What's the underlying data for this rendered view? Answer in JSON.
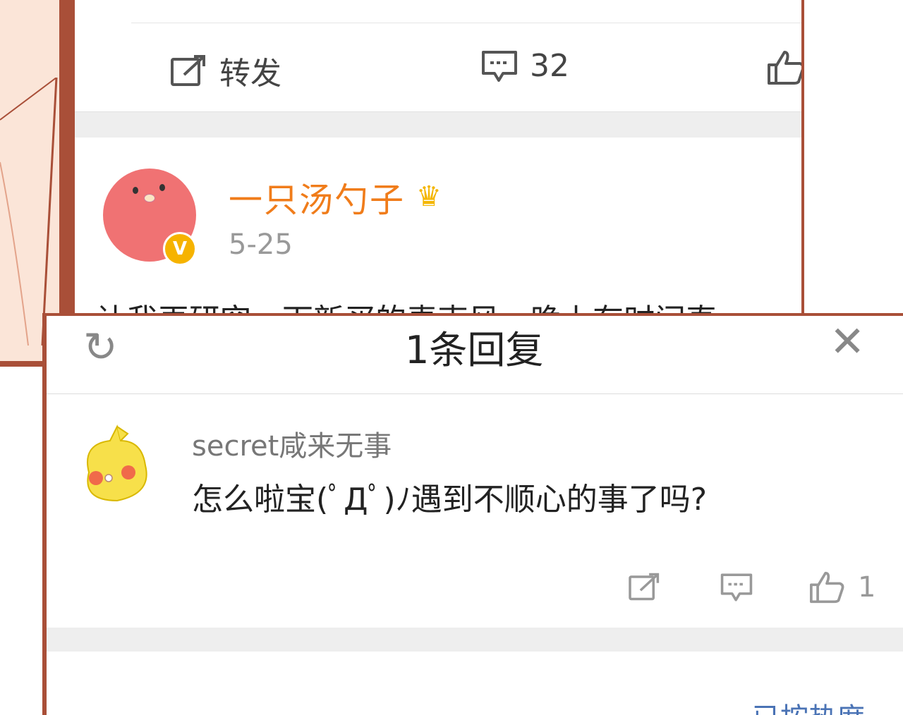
{
  "post": {
    "actions": {
      "share_label": "转发",
      "comment_count": "32"
    },
    "author": {
      "name": "一只汤勺子",
      "verified_badge": "V"
    },
    "date": "5-25",
    "text_partial": "让我再研究一下新买的麦克风，晚上有时间直"
  },
  "replies_dialog": {
    "title": "1条回复",
    "reply": {
      "username": "secret咸来无事",
      "text": "怎么啦宝(ﾟДﾟ)ﾉ遇到不顺心的事了吗?",
      "like_count": "1"
    },
    "bottom_text_partial": "已按热度"
  },
  "colors": {
    "frame_border": "#a94f38",
    "username_orange": "#f07c1a",
    "verified_gold": "#f6b300",
    "avatar_red": "#f07273"
  },
  "icons": [
    "share-icon",
    "comment-icon",
    "like-icon",
    "refresh-icon",
    "close-icon",
    "crown-icon"
  ]
}
